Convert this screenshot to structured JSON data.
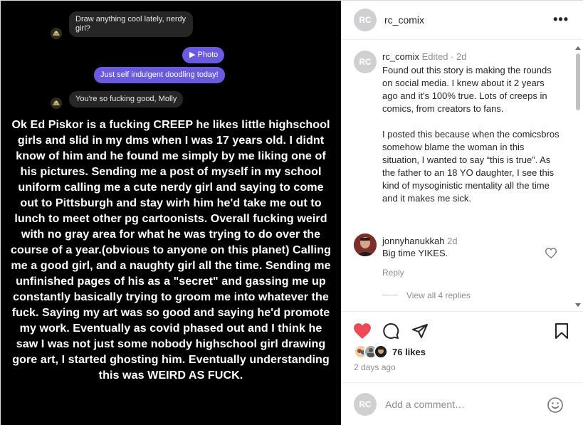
{
  "media": {
    "messages": [
      {
        "side": "in",
        "text": "Draw anything cool lately, nerdy girl?"
      },
      {
        "side": "out",
        "text": "▶ Photo"
      },
      {
        "side": "out",
        "text": "Just self indulgent doodling today!"
      },
      {
        "side": "in",
        "text": "You're so fucking good, Molly"
      }
    ],
    "story": "Ok Ed Piskor is a fucking CREEP he likes little highschool girls and slid in my dms when I was 17 years old. I didnt know of him and he found me simply by me liking one of his pictures. Sending me a post of myself in my school uniform calling me a cute nerdy girl and saying to come out to Pittsburgh and stay wirh him he'd take me out to lunch to meet other pg cartoonists. Overall fucking weird with no gray area for what he was trying to do over the course of a year.(obvious to anyone on this planet) Calling me a good girl, and a naughty girl all the time. Sending me unfinished pages of his as a \"secret\" and gassing me up constantly basically trying to groom me into whatever the fuck. Saying my art was so good and saying he'd promote my work. Eventually as covid phased out and I think he saw I was not just some nobody highschool girl drawing gore art, I started ghosting him. Eventually understanding this was WEIRD AS FUCK."
  },
  "header": {
    "avatar_initials": "RC",
    "username": "rc_comix",
    "more": "•••"
  },
  "caption": {
    "avatar_initials": "RC",
    "username": "rc_comix",
    "meta": "Edited · 2d",
    "text": "Found out this story is making the rounds on social media. I knew about it 2 years ago and it's 100% true. Lots of creeps in comics, from creators to fans.\n\nI posted this because when the comicsbros somehow blame the woman in this situation, I wanted to say “this is true”. As the father to an 18 YO daughter, I see this kind of mysoginistic mentality all the time and it makes me sick."
  },
  "comment": {
    "username": "jonnyhanukkah",
    "meta": "2d",
    "text": "Big time YIKES.",
    "reply": "Reply",
    "view_replies": "View all 4 replies"
  },
  "actions": {
    "likes": "76 likes",
    "date": "2 days ago"
  },
  "add_comment": {
    "avatar_initials": "RC",
    "placeholder": "Add a comment…"
  },
  "colors": {
    "like_red": "#ed4956",
    "sent_bubble": "#6a5ae0",
    "avatar_grey": "#d0d0d3"
  }
}
